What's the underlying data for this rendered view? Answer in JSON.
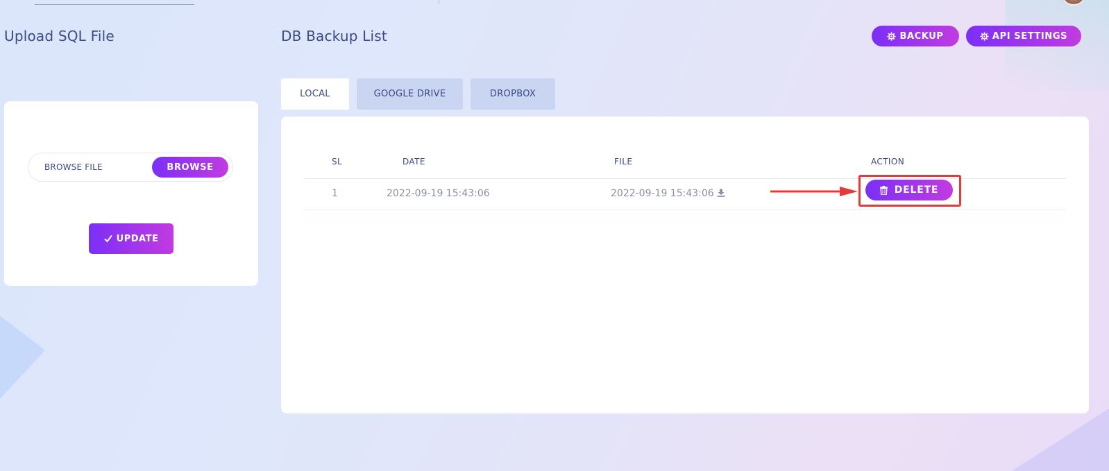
{
  "upload": {
    "heading": "Upload SQL File",
    "file_label": "BROWSE FILE",
    "browse_label": "BROWSE",
    "update_icon": "checkmark-icon",
    "update_label": "UPDATE"
  },
  "backup_list": {
    "heading": "DB Backup List",
    "backup_label": "BACKUP",
    "api_settings_label": "API SETTINGS",
    "button_icon": "gear-icon",
    "tabs": [
      {
        "label": "LOCAL",
        "active": true
      },
      {
        "label": "GOOGLE DRIVE",
        "active": false
      },
      {
        "label": "DROPBOX",
        "active": false
      }
    ],
    "columns": [
      "SL",
      "DATE",
      "FILE",
      "ACTION"
    ],
    "rows": [
      {
        "sl": "1",
        "date": "2022-09-19 15:43:06",
        "file": "2022-09-19 15:43:06",
        "file_icon": "download-icon",
        "action_label": "DELETE",
        "action_icon": "trash-icon"
      }
    ]
  },
  "colors": {
    "accent_start": "#7b2ff7",
    "accent_end": "#c23be0",
    "text": "#3b4a86",
    "muted": "#8a90a8",
    "annotation": "#e53a3a",
    "tab_inactive": "#c9d5f1"
  }
}
